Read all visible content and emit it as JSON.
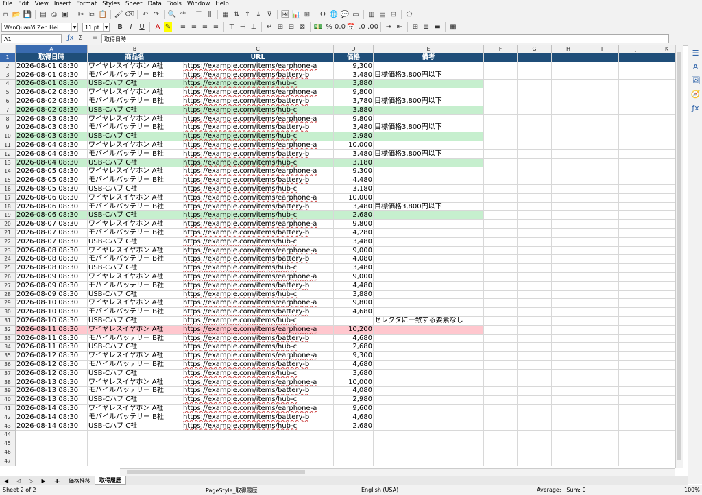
{
  "menu": [
    "File",
    "Edit",
    "View",
    "Insert",
    "Format",
    "Styles",
    "Sheet",
    "Data",
    "Tools",
    "Window",
    "Help"
  ],
  "font_name": "WenQuanYi Zen Hei",
  "font_size": "11 pt",
  "name_box": "A1",
  "formula_content": "取得日時",
  "columns": [
    "A",
    "B",
    "C",
    "D",
    "E",
    "F",
    "G",
    "H",
    "I",
    "J",
    "K"
  ],
  "headers": [
    "取得日時",
    "商品名",
    "URL",
    "価格",
    "備考"
  ],
  "rows": [
    [
      "2026-08-01 08:30",
      "ワイヤレスイヤホン A社",
      "https://example.com/items/earphone-a",
      "9,300",
      ""
    ],
    [
      "2026-08-01 08:30",
      "モバイルバッテリー B社",
      "https://example.com/items/battery-b",
      "3,480",
      "目標価格3,800円以下"
    ],
    [
      "2026-08-01 08:30",
      "USB-Cハブ C社",
      "https://example.com/items/hub-c",
      "3,880",
      ""
    ],
    [
      "2026-08-02 08:30",
      "ワイヤレスイヤホン A社",
      "https://example.com/items/earphone-a",
      "9,800",
      ""
    ],
    [
      "2026-08-02 08:30",
      "モバイルバッテリー B社",
      "https://example.com/items/battery-b",
      "3,780",
      "目標価格3,800円以下"
    ],
    [
      "2026-08-02 08:30",
      "USB-Cハブ C社",
      "https://example.com/items/hub-c",
      "3,880",
      ""
    ],
    [
      "2026-08-03 08:30",
      "ワイヤレスイヤホン A社",
      "https://example.com/items/earphone-a",
      "9,800",
      ""
    ],
    [
      "2026-08-03 08:30",
      "モバイルバッテリー B社",
      "https://example.com/items/battery-b",
      "3,480",
      "目標価格3,800円以下"
    ],
    [
      "2026-08-03 08:30",
      "USB-Cハブ C社",
      "https://example.com/items/hub-c",
      "2,980",
      ""
    ],
    [
      "2026-08-04 08:30",
      "ワイヤレスイヤホン A社",
      "https://example.com/items/earphone-a",
      "10,000",
      ""
    ],
    [
      "2026-08-04 08:30",
      "モバイルバッテリー B社",
      "https://example.com/items/battery-b",
      "3,480",
      "目標価格3,800円以下"
    ],
    [
      "2026-08-04 08:30",
      "USB-Cハブ C社",
      "https://example.com/items/hub-c",
      "3,180",
      ""
    ],
    [
      "2026-08-05 08:30",
      "ワイヤレスイヤホン A社",
      "https://example.com/items/earphone-a",
      "9,300",
      ""
    ],
    [
      "2026-08-05 08:30",
      "モバイルバッテリー B社",
      "https://example.com/items/battery-b",
      "4,480",
      ""
    ],
    [
      "2026-08-05 08:30",
      "USB-Cハブ C社",
      "https://example.com/items/hub-c",
      "3,180",
      ""
    ],
    [
      "2026-08-06 08:30",
      "ワイヤレスイヤホン A社",
      "https://example.com/items/earphone-a",
      "10,000",
      ""
    ],
    [
      "2026-08-06 08:30",
      "モバイルバッテリー B社",
      "https://example.com/items/battery-b",
      "3,480",
      "目標価格3,800円以下"
    ],
    [
      "2026-08-06 08:30",
      "USB-Cハブ C社",
      "https://example.com/items/hub-c",
      "2,680",
      ""
    ],
    [
      "2026-08-07 08:30",
      "ワイヤレスイヤホン A社",
      "https://example.com/items/earphone-a",
      "9,800",
      ""
    ],
    [
      "2026-08-07 08:30",
      "モバイルバッテリー B社",
      "https://example.com/items/battery-b",
      "4,280",
      ""
    ],
    [
      "2026-08-07 08:30",
      "USB-Cハブ C社",
      "https://example.com/items/hub-c",
      "3,480",
      ""
    ],
    [
      "2026-08-08 08:30",
      "ワイヤレスイヤホン A社",
      "https://example.com/items/earphone-a",
      "9,000",
      ""
    ],
    [
      "2026-08-08 08:30",
      "モバイルバッテリー B社",
      "https://example.com/items/battery-b",
      "4,080",
      ""
    ],
    [
      "2026-08-08 08:30",
      "USB-Cハブ C社",
      "https://example.com/items/hub-c",
      "3,480",
      ""
    ],
    [
      "2026-08-09 08:30",
      "ワイヤレスイヤホン A社",
      "https://example.com/items/earphone-a",
      "9,000",
      ""
    ],
    [
      "2026-08-09 08:30",
      "モバイルバッテリー B社",
      "https://example.com/items/battery-b",
      "4,480",
      ""
    ],
    [
      "2026-08-09 08:30",
      "USB-Cハブ C社",
      "https://example.com/items/hub-c",
      "3,880",
      ""
    ],
    [
      "2026-08-10 08:30",
      "ワイヤレスイヤホン A社",
      "https://example.com/items/earphone-a",
      "9,800",
      ""
    ],
    [
      "2026-08-10 08:30",
      "モバイルバッテリー B社",
      "https://example.com/items/battery-b",
      "4,680",
      ""
    ],
    [
      "2026-08-10 08:30",
      "USB-Cハブ C社",
      "https://example.com/items/hub-c",
      "",
      "セレクタに一致する要素なし"
    ],
    [
      "2026-08-11 08:30",
      "ワイヤレスイヤホン A社",
      "https://example.com/items/earphone-a",
      "10,200",
      ""
    ],
    [
      "2026-08-11 08:30",
      "モバイルバッテリー B社",
      "https://example.com/items/battery-b",
      "4,680",
      ""
    ],
    [
      "2026-08-11 08:30",
      "USB-Cハブ C社",
      "https://example.com/items/hub-c",
      "2,680",
      ""
    ],
    [
      "2026-08-12 08:30",
      "ワイヤレスイヤホン A社",
      "https://example.com/items/earphone-a",
      "9,300",
      ""
    ],
    [
      "2026-08-12 08:30",
      "モバイルバッテリー B社",
      "https://example.com/items/battery-b",
      "4,680",
      ""
    ],
    [
      "2026-08-12 08:30",
      "USB-Cハブ C社",
      "https://example.com/items/hub-c",
      "3,680",
      ""
    ],
    [
      "2026-08-13 08:30",
      "ワイヤレスイヤホン A社",
      "https://example.com/items/earphone-a",
      "10,000",
      ""
    ],
    [
      "2026-08-13 08:30",
      "モバイルバッテリー B社",
      "https://example.com/items/battery-b",
      "4,080",
      ""
    ],
    [
      "2026-08-13 08:30",
      "USB-Cハブ C社",
      "https://example.com/items/hub-c",
      "2,980",
      ""
    ],
    [
      "2026-08-14 08:30",
      "ワイヤレスイヤホン A社",
      "https://example.com/items/earphone-a",
      "9,600",
      ""
    ],
    [
      "2026-08-14 08:30",
      "モバイルバッテリー B社",
      "https://example.com/items/battery-b",
      "4,680",
      ""
    ],
    [
      "2026-08-14 08:30",
      "USB-Cハブ C社",
      "https://example.com/items/hub-c",
      "2,680",
      ""
    ]
  ],
  "highlight": {
    "green_rows": [
      2,
      5,
      8,
      11,
      17
    ],
    "pink_rows": [
      30
    ]
  },
  "colors": {
    "header_fill": "#1f4e79",
    "green": "#c6efce",
    "pink": "#ffc7ce",
    "selection": "#3a6bb0"
  },
  "sheet_tabs": [
    "価格推移",
    "取得履歴"
  ],
  "active_tab": "取得履歴",
  "status": {
    "sheet": "Sheet 2 of 2",
    "style": "PageStyle_取得履歴",
    "language": "English (USA)",
    "sum": "Average: ; Sum: 0",
    "zoom": "100%"
  }
}
